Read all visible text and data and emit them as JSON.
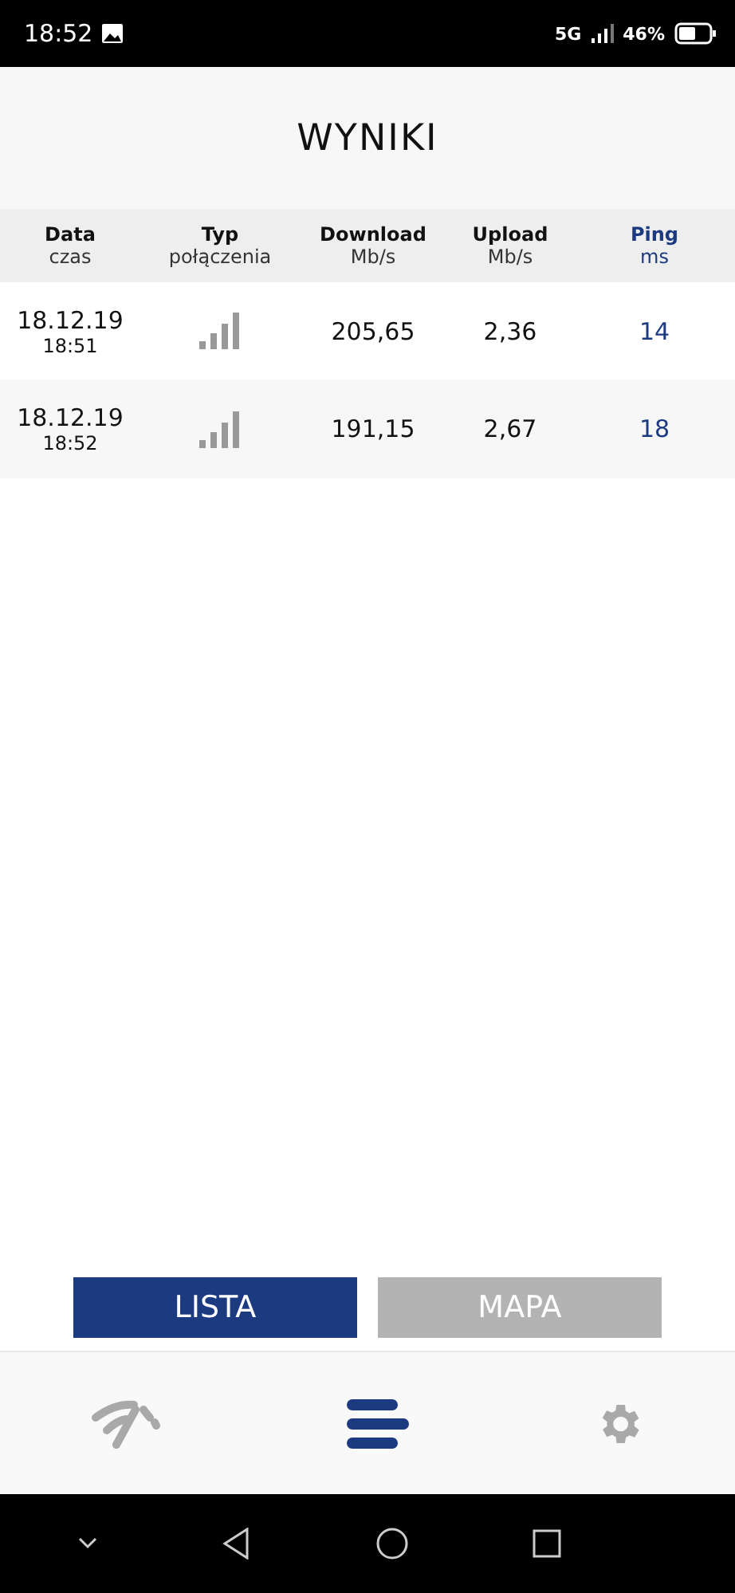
{
  "status_bar": {
    "time": "18:52",
    "network": "5G",
    "battery": "46%"
  },
  "title": "WYNIKI",
  "table": {
    "columns": [
      {
        "label": "Data",
        "unit": "czas",
        "kind": "plain"
      },
      {
        "label": "Typ",
        "unit": "połączenia",
        "kind": "plain"
      },
      {
        "label": "Download",
        "unit": "Mb/s",
        "kind": "plain"
      },
      {
        "label": "Upload",
        "unit": "Mb/s",
        "kind": "plain"
      },
      {
        "label": "Ping",
        "unit": "ms",
        "kind": "accent"
      }
    ],
    "rows": [
      {
        "date": "18.12.19",
        "time": "18:51",
        "download": "205,65",
        "upload": "2,36",
        "ping": "14"
      },
      {
        "date": "18.12.19",
        "time": "18:52",
        "download": "191,15",
        "upload": "2,67",
        "ping": "18"
      }
    ]
  },
  "view_tabs": [
    {
      "label": "LISTA",
      "selected": true
    },
    {
      "label": "MAPA",
      "selected": false
    }
  ],
  "bottom_nav": [
    {
      "kind": "speed",
      "selected": false
    },
    {
      "kind": "list",
      "selected": true
    },
    {
      "kind": "settings",
      "selected": false
    }
  ]
}
